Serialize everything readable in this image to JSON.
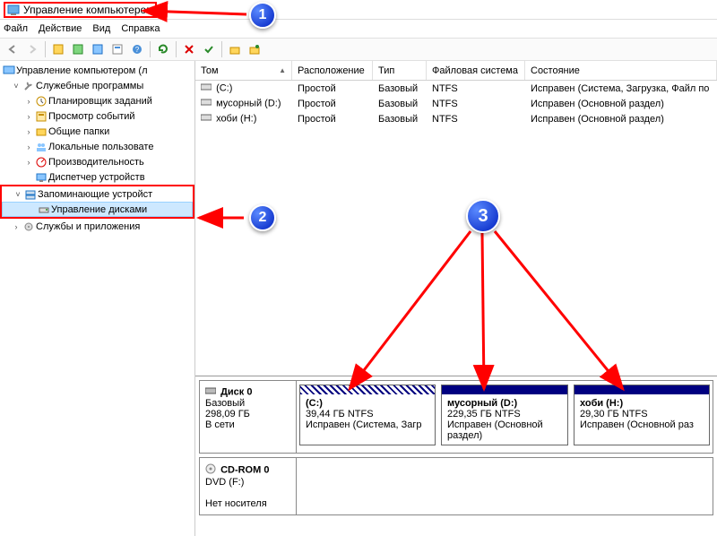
{
  "title": "Управление компьютером",
  "menu": {
    "file": "Файл",
    "action": "Действие",
    "view": "Вид",
    "help": "Справка"
  },
  "tree": {
    "root": "Управление компьютером (л",
    "system_tools": "Служебные программы",
    "task_scheduler": "Планировщик заданий",
    "event_viewer": "Просмотр событий",
    "shared_folders": "Общие папки",
    "local_users": "Локальные пользовате",
    "performance": "Производительность",
    "device_manager": "Диспетчер устройств",
    "storage": "Запоминающие устройст",
    "disk_mgmt": "Управление дисками",
    "services": "Службы и приложения"
  },
  "cols": {
    "vol": "Том",
    "layout": "Расположение",
    "type": "Тип",
    "fs": "Файловая система",
    "status": "Состояние"
  },
  "vols": [
    {
      "name": "(C:)",
      "layout": "Простой",
      "type": "Базовый",
      "fs": "NTFS",
      "status": "Исправен (Система, Загрузка, Файл по"
    },
    {
      "name": "мусорный (D:)",
      "layout": "Простой",
      "type": "Базовый",
      "fs": "NTFS",
      "status": "Исправен (Основной раздел)"
    },
    {
      "name": "хоби (H:)",
      "layout": "Простой",
      "type": "Базовый",
      "fs": "NTFS",
      "status": "Исправен (Основной раздел)"
    }
  ],
  "disk0": {
    "name": "Диск 0",
    "type": "Базовый",
    "size": "298,09 ГБ",
    "online": "В сети",
    "p1": {
      "name": "(C:)",
      "size": "39,44 ГБ NTFS",
      "status": "Исправен (Система, Загр"
    },
    "p2": {
      "name": "мусорный (D:)",
      "size": "229,35 ГБ NTFS",
      "status": "Исправен (Основной раздел)"
    },
    "p3": {
      "name": "хоби (H:)",
      "size": "29,30 ГБ NTFS",
      "status": "Исправен (Основной раз"
    }
  },
  "cdrom": {
    "name": "CD-ROM 0",
    "type": "DVD (F:)",
    "status": "Нет носителя"
  }
}
